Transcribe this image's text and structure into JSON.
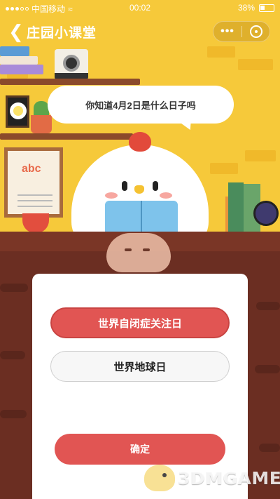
{
  "status_bar": {
    "carrier": "中国移动",
    "time": "00:02",
    "battery": "38%",
    "signal_icon": "signal-dots-icon",
    "wifi_icon": "wifi-icon",
    "battery_icon": "battery-icon"
  },
  "nav": {
    "back_icon": "chevron-left-icon",
    "title": "庄园小课堂",
    "more_label": "•••",
    "close_icon": "target-close-icon"
  },
  "question": {
    "text": "你知道4月2日是什么日子吗"
  },
  "board": {
    "letters": "abc"
  },
  "options": [
    {
      "label": "世界自闭症关注日",
      "selected": true
    },
    {
      "label": "世界地球日",
      "selected": false
    }
  ],
  "confirm": {
    "label": "确定"
  },
  "watermark": {
    "text": "3DMGAME"
  },
  "colors": {
    "wall": "#f6c93a",
    "table": "#6b2e22",
    "accent_red": "#e15553"
  }
}
